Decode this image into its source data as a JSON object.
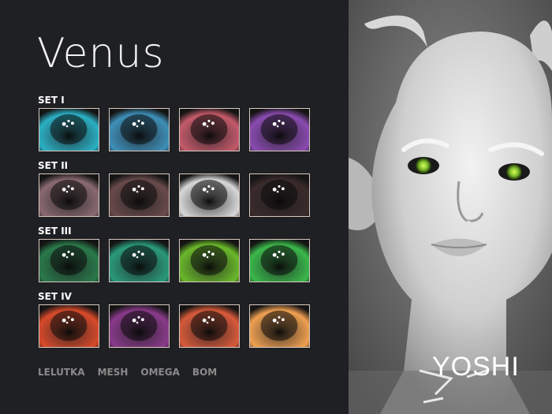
{
  "title": "Venus",
  "sets": [
    {
      "label": "SET I",
      "colors": [
        "#2bb0c4",
        "#3e8fb8",
        "#c45a6a",
        "#8a4bb0"
      ]
    },
    {
      "label": "SET II",
      "colors": [
        "#8a6a70",
        "#6a4a4a",
        "#d8d8d8",
        "#3a2a2a"
      ]
    },
    {
      "label": "SET III",
      "colors": [
        "#2a7a4a",
        "#2a9a7a",
        "#6ab82a",
        "#3ab84a"
      ]
    },
    {
      "label": "SET IV",
      "colors": [
        "#d84a2a",
        "#8a3a8a",
        "#d85a3a",
        "#f0a050"
      ]
    }
  ],
  "footer": [
    "LELUTKA",
    "MESH",
    "OMEGA",
    "BOM"
  ],
  "brand": "YOSHI"
}
